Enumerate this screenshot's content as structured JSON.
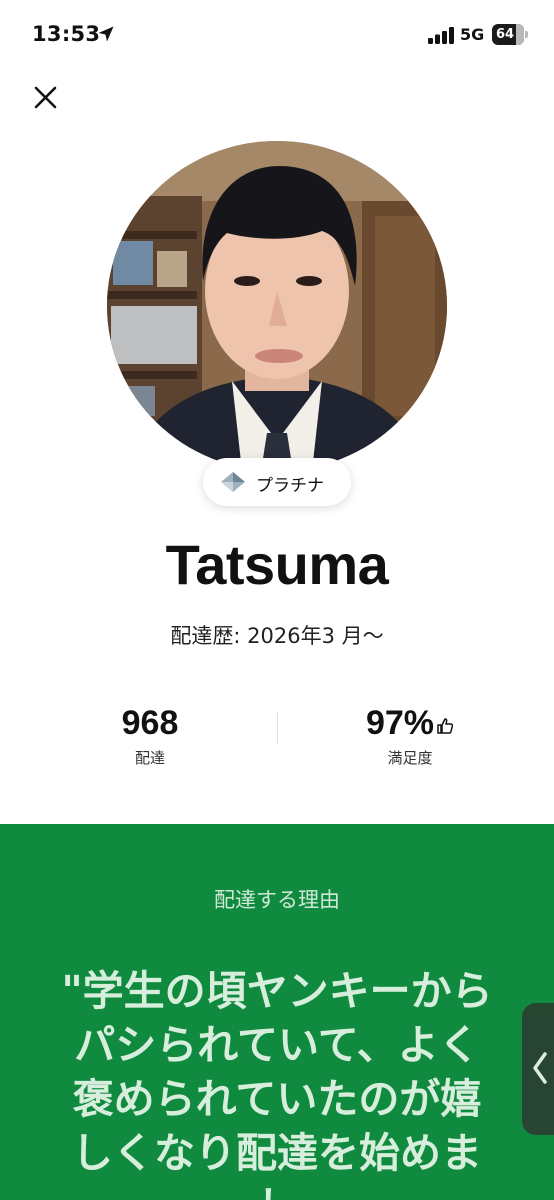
{
  "status_bar": {
    "time": "13:53",
    "network": "5G",
    "battery": "64"
  },
  "profile": {
    "tier": "プラチナ",
    "name": "Tatsuma",
    "delivery_since": "配達歴: 2026年3 月〜"
  },
  "stats": [
    {
      "value": "968",
      "label": "配達"
    },
    {
      "value": "97%",
      "label": "満足度"
    }
  ],
  "reason": {
    "heading": "配達する理由",
    "quote": "\"学生の頃ヤンキーからパシられていて、よく褒められていたのが嬉しくなり配達を始めまし"
  },
  "colors": {
    "accent_green": "#108a3e"
  },
  "icons": [
    "navigation-arrow-icon",
    "cellular-signal-icon",
    "battery-icon",
    "close-icon",
    "diamond-icon",
    "thumbs-up-icon",
    "chevron-left-icon"
  ]
}
